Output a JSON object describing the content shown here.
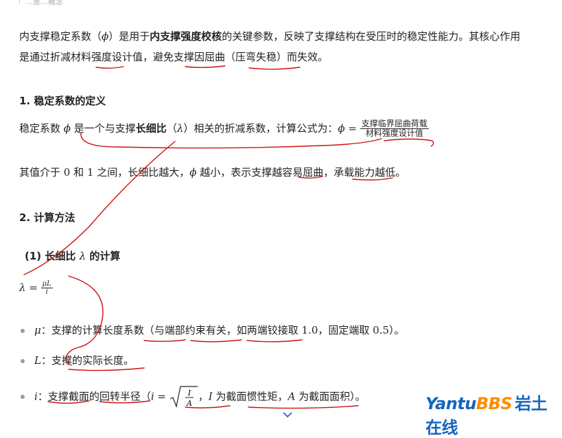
{
  "header": {
    "text": "…是…概念"
  },
  "intro": {
    "line1_a": "内支撑稳定系数（",
    "line1_phi": "ϕ",
    "line1_b": "）是用于",
    "line1_bold": "内支撑强度校核",
    "line1_c": "的关键参数，反映了支撑结构在受压时的稳定性能力。其核心作用",
    "line2": "是通过折减材料强度设计值，避免支撑因屈曲（压弯失稳）而失效。"
  },
  "section1": {
    "title": "1. 稳定系数的定义",
    "def_a": "稳定系数 ",
    "def_phi": "ϕ",
    "def_b": " 是一个与支撑",
    "def_bold": "长细比",
    "def_c": "（",
    "def_lambda": "λ",
    "def_d": "）相关的折减系数，计算公式为：",
    "formula_lhs": "ϕ =",
    "formula_num": "支撑临界屈曲荷载",
    "formula_den": "材料强度设计值",
    "range_a": "其值介于 ",
    "range_zero": "0",
    "range_b": " 和 ",
    "range_one": "1",
    "range_c": " 之间，长细比越大，",
    "range_phi": "ϕ",
    "range_d": " 越小，表示支撑越容易屈曲，承载能力越低。"
  },
  "section2": {
    "title": "2. 计算方法",
    "sub_title_a": "(1) 长细比 ",
    "sub_title_lambda": "λ",
    "sub_title_b": " 的计算",
    "formula_lhs": "λ =",
    "formula_num": "μL",
    "formula_den": "i",
    "bullets": {
      "mu_sym": "μ",
      "mu_text": "：支撑的计算长度系数（与端部约束有关，如两端铰接取 ",
      "mu_v1": "1.0",
      "mu_text2": "，固定端取 ",
      "mu_v2": "0.5",
      "mu_text3": "）。",
      "L_sym": "L",
      "L_text": "：支撑的实际长度。",
      "i_sym": "i",
      "i_text": "：支撑截面的回转半径（",
      "i_formula_lhs": "i =",
      "i_frac_num": "I",
      "i_frac_den": "A",
      "i_text2": "，",
      "I_sym": "I",
      "i_text3": " 为截面惯性矩，",
      "A_sym": "A",
      "i_text4": " 为截面面积）。"
    }
  },
  "watermark": {
    "part1": "Yantu",
    "part2": "BBS",
    "part3": "岩土在线"
  },
  "colors": {
    "ink": "#cc1010",
    "logo_blue": "#1565c0",
    "logo_orange": "#ff8c00"
  },
  "icons": {
    "scroll": "chevron-down-icon"
  }
}
